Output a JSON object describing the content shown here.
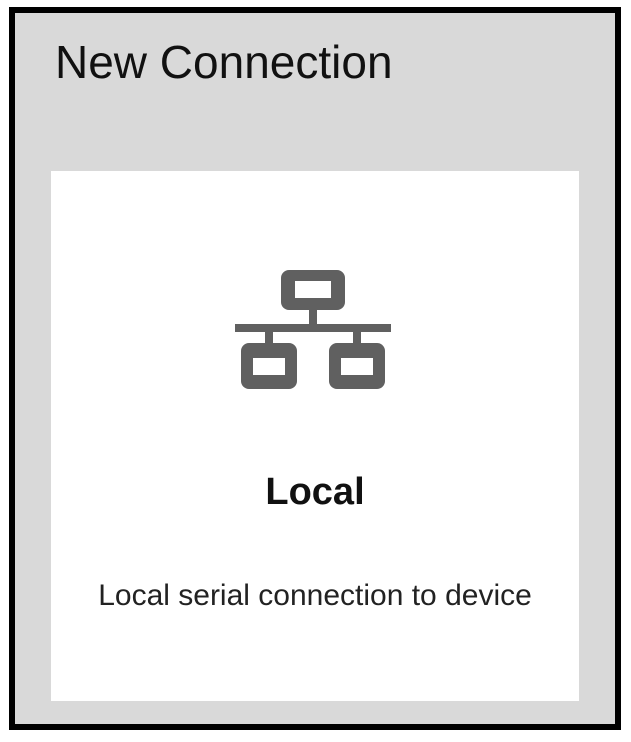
{
  "dialog": {
    "title": "New Connection"
  },
  "connection_option": {
    "icon": "network-icon",
    "title": "Local",
    "description": "Local serial connection to device"
  },
  "colors": {
    "background": "#d9d9d9",
    "card": "#ffffff",
    "border": "#000000",
    "icon": "#606060"
  }
}
